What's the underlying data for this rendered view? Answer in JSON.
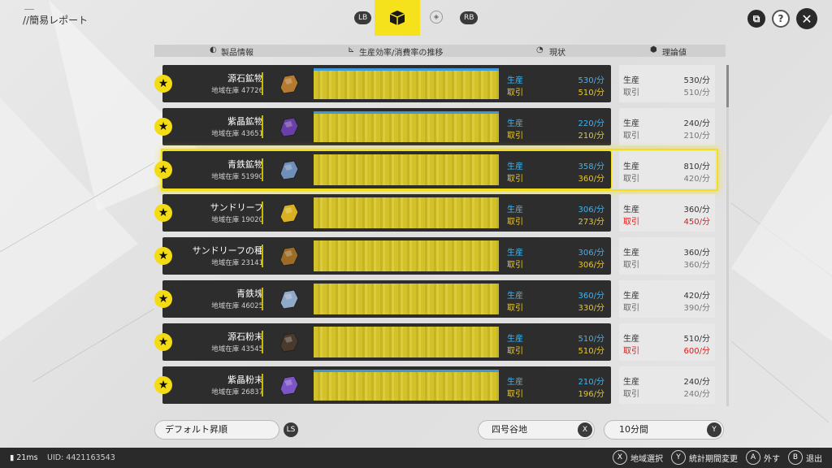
{
  "title": "//簡易レポート",
  "tabbar": {
    "left_button": "LB",
    "right_button": "RB"
  },
  "columns": {
    "product": "製品情報",
    "trend": "生産効率/消費率の推移",
    "current": "現状",
    "theory": "理論値"
  },
  "labels": {
    "produce": "生産",
    "take": "取引"
  },
  "rows": [
    {
      "name": "源石鉱物",
      "stock": "地域在庫 47726",
      "cur_produce": "530/分",
      "cur_take": "510/分",
      "th_produce": "530/分",
      "th_take": "510/分",
      "th_take_red": false,
      "bar_fill": 1.0
    },
    {
      "name": "紫晶鉱物",
      "stock": "地域在庫 43651",
      "cur_produce": "220/分",
      "cur_take": "210/分",
      "th_produce": "240/分",
      "th_take": "210/分",
      "th_take_red": false,
      "bar_fill": 1.0
    },
    {
      "name": "青鉄鉱物",
      "stock": "地域在庫 51990",
      "cur_produce": "358/分",
      "cur_take": "360/分",
      "th_produce": "810/分",
      "th_take": "420/分",
      "th_take_red": false,
      "bar_fill": 0.0,
      "selected": true
    },
    {
      "name": "サンドリーフ",
      "stock": "地域在庫 19020",
      "cur_produce": "306/分",
      "cur_take": "273/分",
      "th_produce": "360/分",
      "th_take": "450/分",
      "th_take_red": true,
      "bar_fill": 0.0
    },
    {
      "name": "サンドリーフの種",
      "stock": "地域在庫 23141",
      "cur_produce": "306/分",
      "cur_take": "306/分",
      "th_produce": "360/分",
      "th_take": "360/分",
      "th_take_red": false,
      "bar_fill": 0.0
    },
    {
      "name": "青鉄塊",
      "stock": "地域在庫 46025",
      "cur_produce": "360/分",
      "cur_take": "330/分",
      "th_produce": "420/分",
      "th_take": "390/分",
      "th_take_red": false,
      "bar_fill": 0.0
    },
    {
      "name": "源石粉末",
      "stock": "地域在庫 43545",
      "cur_produce": "510/分",
      "cur_take": "510/分",
      "th_produce": "510/分",
      "th_take": "600/分",
      "th_take_red": true,
      "bar_fill": 0.0
    },
    {
      "name": "紫晶粉末",
      "stock": "地域在庫 26837",
      "cur_produce": "210/分",
      "cur_take": "196/分",
      "th_produce": "240/分",
      "th_take": "240/分",
      "th_take_red": false,
      "bar_fill": 1.0
    }
  ],
  "controls": {
    "sort": "デフォルト昇順",
    "sort_button": "LS",
    "region": "四号谷地",
    "region_button": "X",
    "period": "10分間",
    "period_button": "Y"
  },
  "footer": {
    "ping": "21ms",
    "uid": "UID: 4421163543",
    "hints": [
      {
        "key": "X",
        "label": "地域選択"
      },
      {
        "key": "Y",
        "label": "統計期間変更"
      },
      {
        "key": "A",
        "label": "外す"
      },
      {
        "key": "B",
        "label": "退出"
      }
    ]
  },
  "colors": {
    "accent": "#f4dc15",
    "produce": "#3fb4f0",
    "take": "#e9c62a",
    "warning": "#e21818"
  },
  "icons": [
    "star-icon",
    "cube-icon",
    "help-icon",
    "close-icon",
    "wifi-signal-icon"
  ]
}
